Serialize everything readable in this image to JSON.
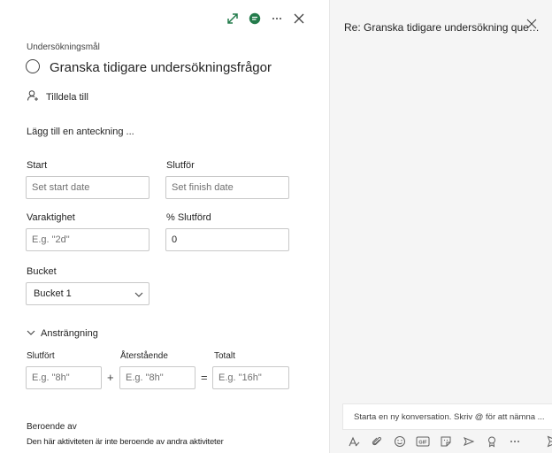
{
  "task": {
    "section_label": "Undersökningsmål",
    "title": "Granska tidigare undersökningsfrågor",
    "assign_label": "Tilldela till",
    "note_placeholder": "Lägg till en anteckning ..."
  },
  "fields": {
    "start_label": "Start",
    "start_placeholder": "Set start date",
    "finish_label": "Slutför",
    "finish_placeholder": "Set finish date",
    "duration_label": "Varaktighet",
    "duration_placeholder": "E.g. \"2d\"",
    "percent_label": "% Slutförd",
    "percent_value": "0",
    "bucket_label": "Bucket",
    "bucket_value": "Bucket 1"
  },
  "effort": {
    "section_label": "Ansträngning",
    "completed_label": "Slutfört",
    "completed_placeholder": "E.g. \"8h\"",
    "remaining_label": "Återstående",
    "remaining_placeholder": "E.g. \"8h\"",
    "total_label": "Totalt",
    "total_placeholder": "E.g. \"16h\"",
    "plus": "+",
    "equals": "="
  },
  "dependencies": {
    "label": "Beroende av",
    "text": "Den här aktiviteten är inte beroende av andra aktiviteter"
  },
  "chat": {
    "title": "Re: Granska tidigare undersökning ques...",
    "compose_placeholder": "Starta en ny konversation. Skriv @ för att nämna ..."
  },
  "colors": {
    "accent": "#6264a7",
    "expand_icon": "#237b4b",
    "chat_icon": "#237b4b"
  },
  "icons": [
    "expand-icon",
    "chat-icon",
    "more-icon",
    "close-icon",
    "person-add-icon",
    "chevron-down-icon",
    "format-icon",
    "attach-icon",
    "emoji-icon",
    "gif-icon",
    "sticker-icon",
    "meet-icon",
    "praise-icon",
    "send-icon"
  ]
}
